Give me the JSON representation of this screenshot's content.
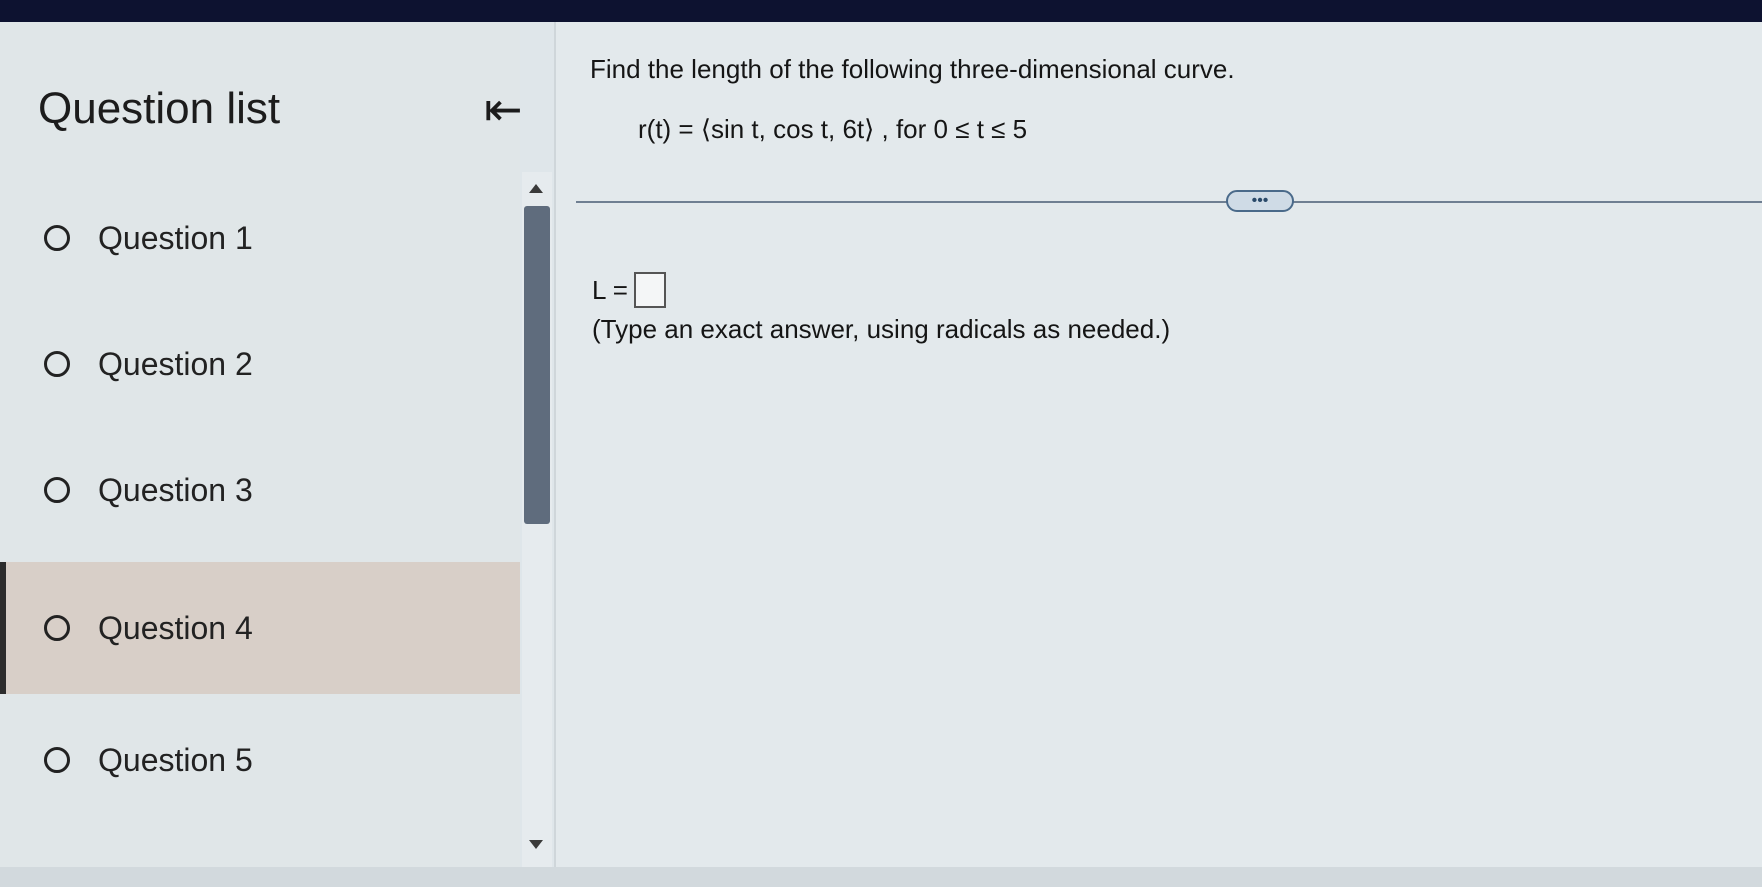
{
  "sidebar": {
    "title": "Question list",
    "collapse_icon": "collapse-left-arrow-icon",
    "items": [
      {
        "label": "Question 1",
        "active": false
      },
      {
        "label": "Question 2",
        "active": false
      },
      {
        "label": "Question 3",
        "active": false
      },
      {
        "label": "Question 4",
        "active": true
      },
      {
        "label": "Question 5",
        "active": false
      }
    ]
  },
  "main": {
    "question_text": "Find the length of the following three-dimensional curve.",
    "equation": "r(t) = ⟨sin t, cos t, 6t⟩ , for 0 ≤ t ≤ 5",
    "more_button": "•••",
    "answer_label": "L =",
    "answer_value": "",
    "hint": "(Type an exact answer, using radicals as needed.)"
  }
}
